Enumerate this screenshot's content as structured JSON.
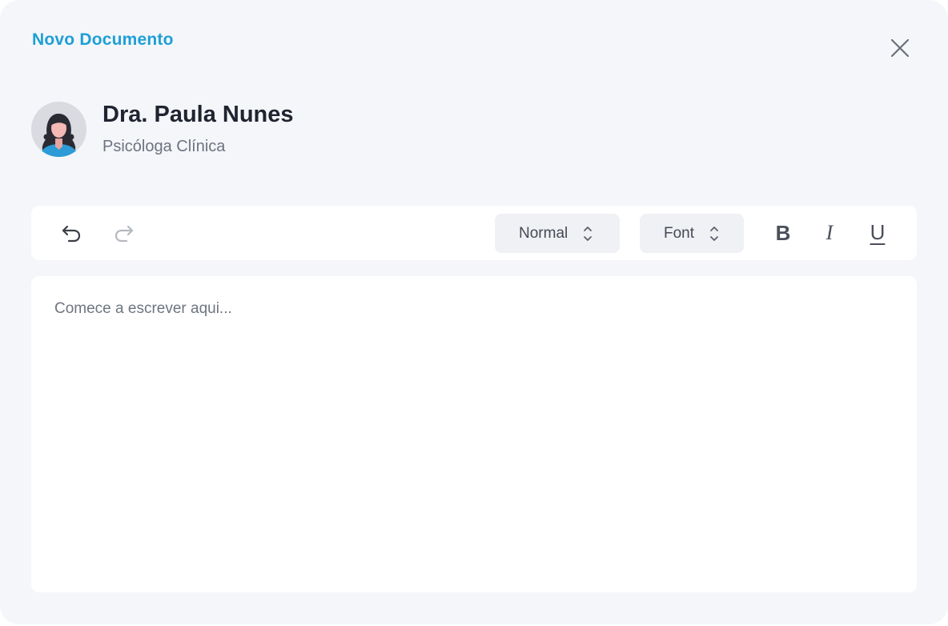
{
  "modal": {
    "title": "Novo Documento"
  },
  "profile": {
    "name": "Dra. Paula Nunes",
    "role": "Psicóloga Clínica"
  },
  "toolbar": {
    "paragraph_style": "Normal",
    "font": "Font",
    "bold_label": "B",
    "italic_label": "I",
    "underline_label": "U"
  },
  "editor": {
    "placeholder": "Comece a escrever aqui...",
    "value": ""
  },
  "icons": {
    "undo": "undo-icon",
    "redo": "redo-icon",
    "close": "close-icon",
    "avatar": "avatar-woman",
    "select_arrows": "chevron-up-down-icon"
  },
  "colors": {
    "accent": "#1e9fd6",
    "background": "#f5f6fa",
    "panel": "#ffffff",
    "select_bg": "#f0f1f4",
    "text_primary": "#1f2430",
    "text_secondary": "#6d7380"
  }
}
